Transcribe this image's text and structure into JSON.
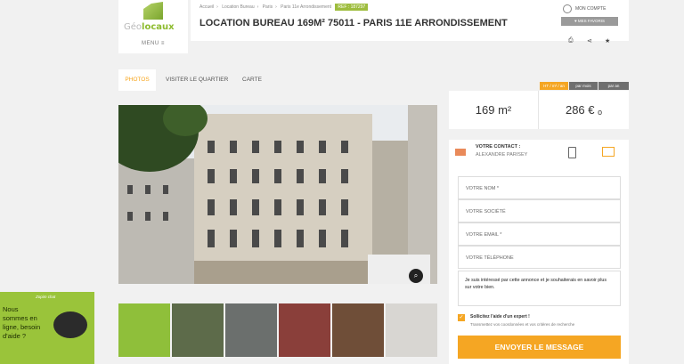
{
  "logo": {
    "text_a": "Géo",
    "text_b": "locaux",
    "menu": "MENU ≡"
  },
  "breadcrumb": [
    "Accueil",
    "Location Bureau",
    "Paris",
    "Paris 11e Arrondissement"
  ],
  "ref_badge": "REF : 187297",
  "page_title": "LOCATION BUREAU 169M² 75011 - PARIS 11E ARRONDISSEMENT",
  "account": {
    "label": "MON COMPTE",
    "favorites": "♥ MES FAVORIS"
  },
  "tools": {
    "print": "⎙",
    "share": "⋖",
    "favorite": "★"
  },
  "tabs": [
    {
      "label": "PHOTOS"
    },
    {
      "label": "VISITER LE QUARTIER"
    },
    {
      "label": "CARTE"
    }
  ],
  "price_tabs": [
    "HT / m² / an",
    "par mois",
    "par an"
  ],
  "stats": {
    "surface": "169 m²",
    "price": "286 € ₒ"
  },
  "contact": {
    "label": "VOTRE CONTACT :",
    "name": "ALEXANDRE PARISEY"
  },
  "form": {
    "name_placeholder": "VOTRE NOM *",
    "company_placeholder": "VOTRE SOCIÉTÉ",
    "email_placeholder": "VOTRE EMAIL *",
    "phone_placeholder": "VOTRE TÉLÉPHONE",
    "message": "Je suis intéressé par cette annonce et je souhaiterais en savoir plus sur votre bien.",
    "consent_title": "Sollicitez l'aide d'un expert !",
    "consent_sub": "Transmettez vos coordonnées et vos critères de recherche",
    "send": "ENVOYER LE MESSAGE"
  },
  "chat": {
    "header": "Zopim chat",
    "text": "Nous sommes en ligne, besoin d'aide ?"
  },
  "colors": {
    "accent": "#f5a623",
    "brand_green": "#8dbb2e",
    "chat_green": "#9ac43a"
  }
}
